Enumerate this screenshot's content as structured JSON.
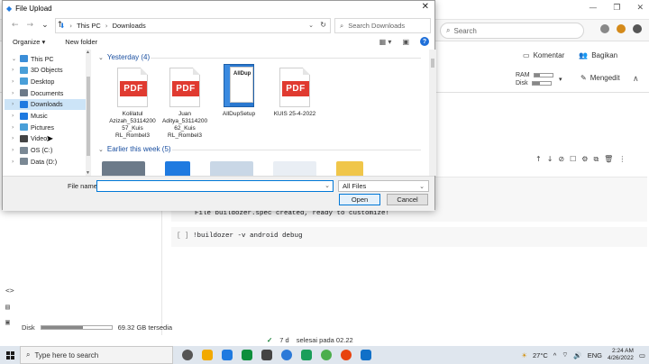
{
  "browser": {
    "search_placeholder": "Search",
    "window_controls": [
      "—",
      "❐",
      "✕"
    ]
  },
  "colab": {
    "comment_label": "Komentar",
    "share_label": "Bagikan",
    "ram_label": "RAM",
    "disk_label": "Disk",
    "edit_label": "Mengedit",
    "cell_output": "File buildozer.spec created, ready to customize!",
    "cell_bracket": "[ ]",
    "cell_code": "!buildozer -v android debug",
    "disk_footer_label": "Disk",
    "disk_footer_value": "69.32 GB tersedia",
    "disk_footer_fill": 0.6,
    "status_time": "7 d",
    "status_text": "selesai pada 02.22",
    "cell_toolbar_icons": [
      "↑",
      "↓",
      "⊘",
      "☐",
      "⚙",
      "⧉",
      "🗑",
      "⋮"
    ]
  },
  "taskbar": {
    "search_placeholder": "Type here to search",
    "weather": "27°C",
    "lang": "ENG",
    "time": "2:24 AM",
    "date": "4/26/2022",
    "app_colors": [
      "#555555",
      "#f2a900",
      "#1f7ae0",
      "#0d8f3c",
      "#444444",
      "#2b79d8",
      "#1a9e5a",
      "#4cae4c",
      "#e8440f",
      "#1070c8"
    ]
  },
  "dialog": {
    "title": "File Upload",
    "breadcrumb": [
      "This PC",
      "Downloads"
    ],
    "search_placeholder": "Search Downloads",
    "organize_label": "Organize ▾",
    "new_folder_label": "New folder",
    "tree": [
      {
        "label": "This PC",
        "color": "#3b8ed8",
        "expanded": true
      },
      {
        "label": "3D Objects",
        "color": "#4a9fd8"
      },
      {
        "label": "Desktop",
        "color": "#4a9fd8"
      },
      {
        "label": "Documents",
        "color": "#6c7a89"
      },
      {
        "label": "Downloads",
        "color": "#1f7ae0",
        "selected": true
      },
      {
        "label": "Music",
        "color": "#1f7ae0"
      },
      {
        "label": "Pictures",
        "color": "#4a9fd8"
      },
      {
        "label": "Videos",
        "color": "#444444"
      },
      {
        "label": "OS (C:)",
        "color": "#7a8894"
      },
      {
        "label": "Data (D:)",
        "color": "#7a8894"
      }
    ],
    "group_yesterday": "Yesterday (4)",
    "group_earlier": "Earlier this week (5)",
    "files": [
      {
        "name": "Kolilatul Azizah_53114200 57_Kuis RL_Rombel3",
        "type": "pdf"
      },
      {
        "name": "Juan Aditya_53114200 62_Kuis RL_Rombel3",
        "type": "pdf"
      },
      {
        "name": "AllDupSetup",
        "type": "setup",
        "badge": "AllDup"
      },
      {
        "name": "KUIS 25-4-2022",
        "type": "pdf"
      }
    ],
    "pdf_badge": "PDF",
    "file_name_label": "File name:",
    "file_name_value": "",
    "file_type": "All Files",
    "open_label": "Open",
    "cancel_label": "Cancel"
  }
}
